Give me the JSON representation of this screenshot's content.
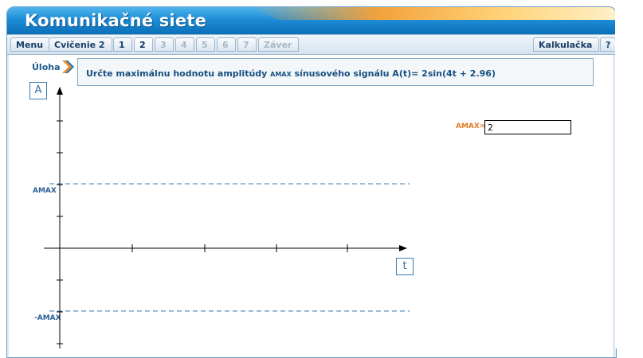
{
  "app": {
    "title": "Komunikačné siete"
  },
  "tabs": {
    "menu": "Menu",
    "exercise": "Cvičenie 2",
    "t1": "1",
    "t2": "2",
    "t3": "3",
    "t4": "4",
    "t5": "5",
    "t6": "6",
    "t7": "7",
    "zaver": "Záver",
    "calc": "Kalkulačka",
    "help": "?"
  },
  "task": {
    "label": "Úloha",
    "text_prefix": "Určte maximálnu hodnotu amplitúdy ",
    "text_sub": "AMAX",
    "text_suffix": "  sínusového signálu A(t)= 2sin(4t + 2.96)"
  },
  "answer": {
    "label": "AMAX=",
    "value": "2"
  },
  "graph": {
    "y_axis_label": "A",
    "x_axis_label": "t",
    "amax_label": "AMAX",
    "neg_amax_label": "-AMAX"
  },
  "colors": {
    "header_blue": "#1e8ed7",
    "accent_orange": "#f2a23a",
    "label_blue": "#2a5f93",
    "answer_orange": "#e07a20",
    "dashed_line": "#3b7bb0"
  }
}
